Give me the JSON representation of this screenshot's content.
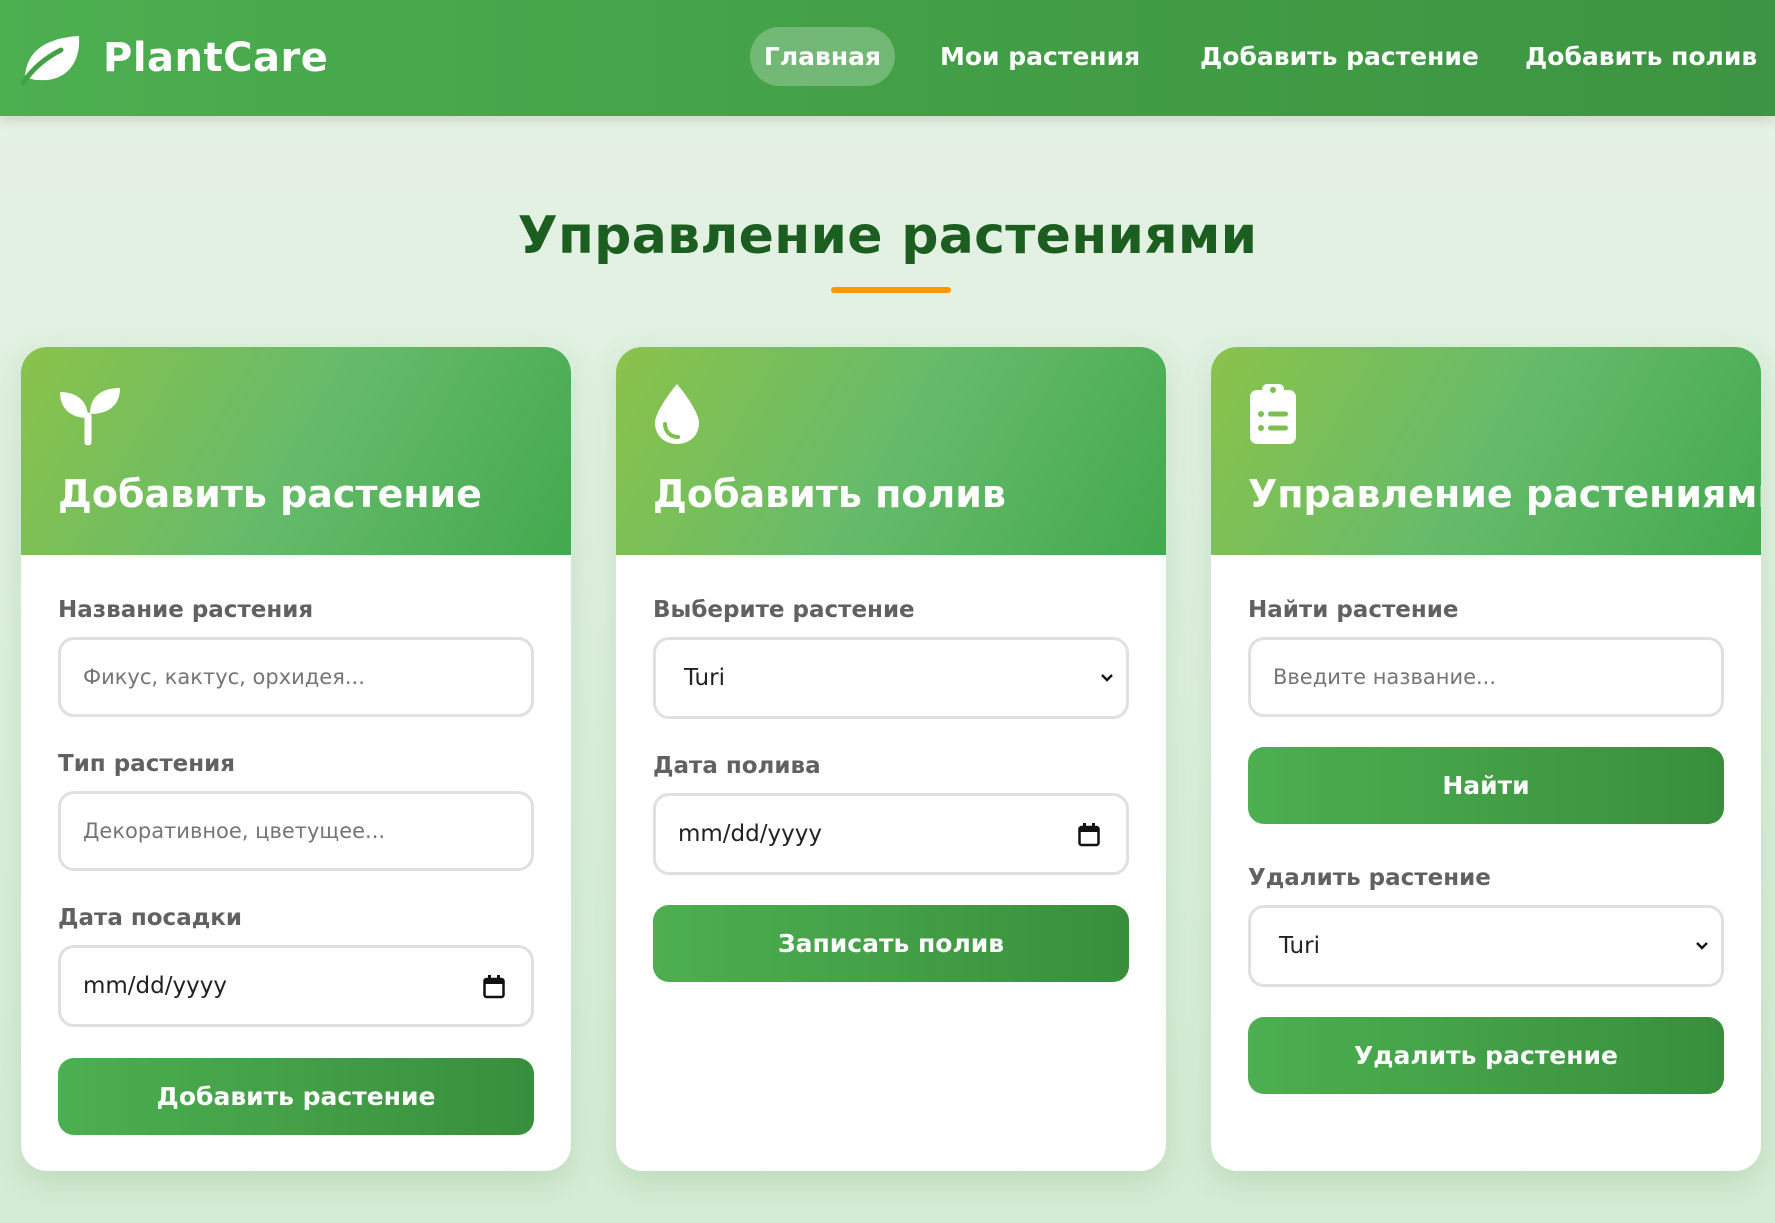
{
  "navbar": {
    "brand": "PlantCare",
    "links": [
      "Главная",
      "Мои растения",
      "Добавить растение",
      "Добавить полив"
    ],
    "active_link": "Главная"
  },
  "page": {
    "title": "Управление растениями",
    "accent_color": "#ff9800",
    "title_color": "#1b5e20"
  },
  "cards": [
    {
      "icon": "sprout-icon",
      "title": "Добавить растение",
      "fields": [
        {
          "label": "Название растения",
          "placeholder": "Фикус, кактус, орхидея..."
        },
        {
          "label": "Тип растения",
          "placeholder": "Декоративное, цветущее..."
        },
        {
          "label": "Дата посадки",
          "value": "mm/dd/yyyy"
        }
      ],
      "button": "Добавить растение"
    },
    {
      "icon": "droplet-icon",
      "title": "Добавить полив",
      "fields": [
        {
          "label": "Выберите растение",
          "value": "Turi"
        },
        {
          "label": "Дата полива",
          "value": "mm/dd/yyyy"
        }
      ],
      "button": "Записать полив"
    },
    {
      "icon": "clipboard-list-icon",
      "title": "Управление растениями",
      "fields": [
        {
          "label": "Найти растение",
          "placeholder": "Введите название..."
        },
        {
          "label": "Удалить растение",
          "value": "Turi"
        }
      ],
      "search_button": "Найти",
      "button": "Удалить растение"
    }
  ]
}
